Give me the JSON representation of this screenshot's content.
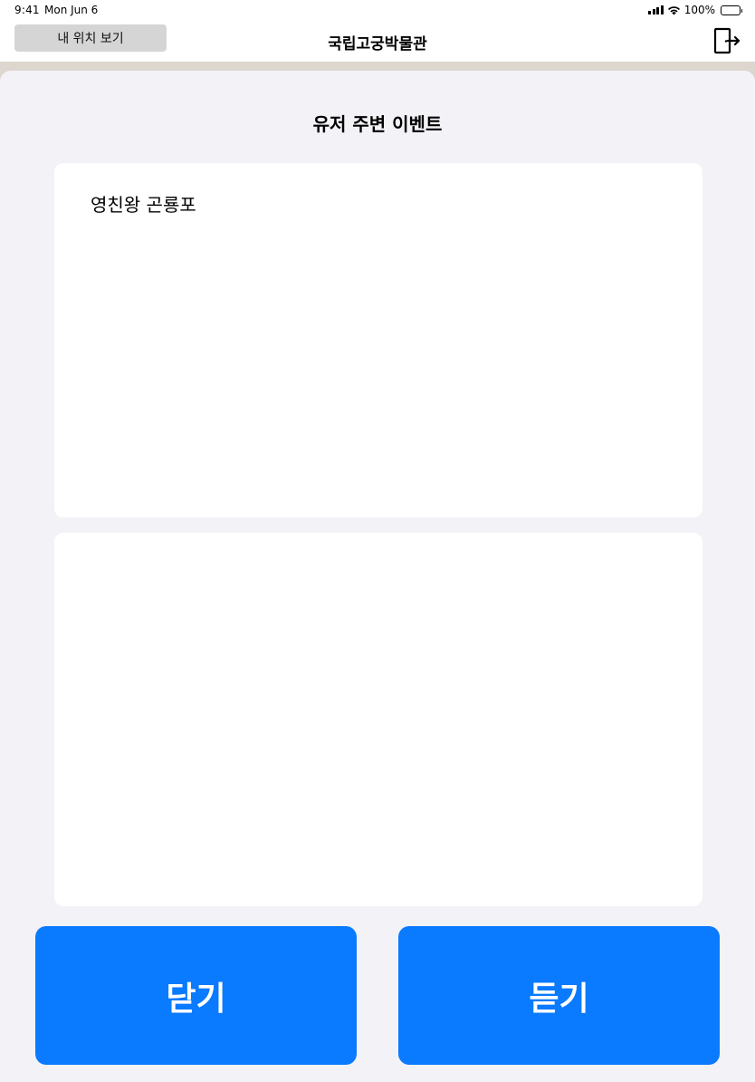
{
  "status_bar": {
    "time": "9:41",
    "date": "Mon Jun 6",
    "battery": "100%",
    "signal_icon": "cellular-signal-icon",
    "wifi_icon": "wifi-icon",
    "battery_icon": "battery-icon"
  },
  "nav": {
    "location_button_label": "내 위치 보기",
    "title": "국립고궁박물관",
    "exit_icon": "exit-door-icon"
  },
  "sheet": {
    "title": "유저 주변 이벤트",
    "top_card": {
      "text": "영친왕 곤룡포"
    },
    "bottom_card": {
      "text": ""
    },
    "buttons": {
      "close_label": "닫기",
      "listen_label": "듣기"
    }
  },
  "colors": {
    "accent": "#0A7AFF",
    "sheet_background": "#F2F2F7",
    "backdrop": "#DDD6CF",
    "location_button_background": "#D5D5D5"
  }
}
